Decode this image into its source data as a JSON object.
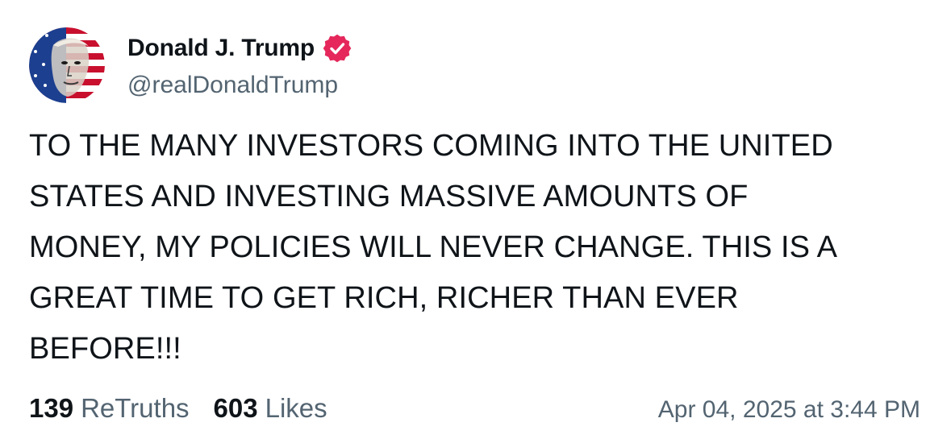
{
  "author": {
    "display_name": "Donald J. Trump",
    "handle": "@realDonaldTrump",
    "verified_badge_icon": "verified-check-icon",
    "verified_color": "#e5275c"
  },
  "post": {
    "lines": [
      "TO THE MANY INVESTORS COMING INTO THE UNITED",
      "STATES AND INVESTING MASSIVE AMOUNTS OF",
      "MONEY, MY POLICIES WILL NEVER CHANGE. THIS IS A",
      "GREAT TIME TO GET RICH, RICHER THAN EVER",
      "BEFORE!!!"
    ]
  },
  "stats": {
    "retruths_count": "139",
    "retruths_label": "ReTruths",
    "likes_count": "603",
    "likes_label": "Likes"
  },
  "timestamp": "Apr 04, 2025 at 3:44 PM",
  "colors": {
    "text_primary": "#0f1419",
    "text_secondary": "#536471",
    "background": "#ffffff"
  }
}
